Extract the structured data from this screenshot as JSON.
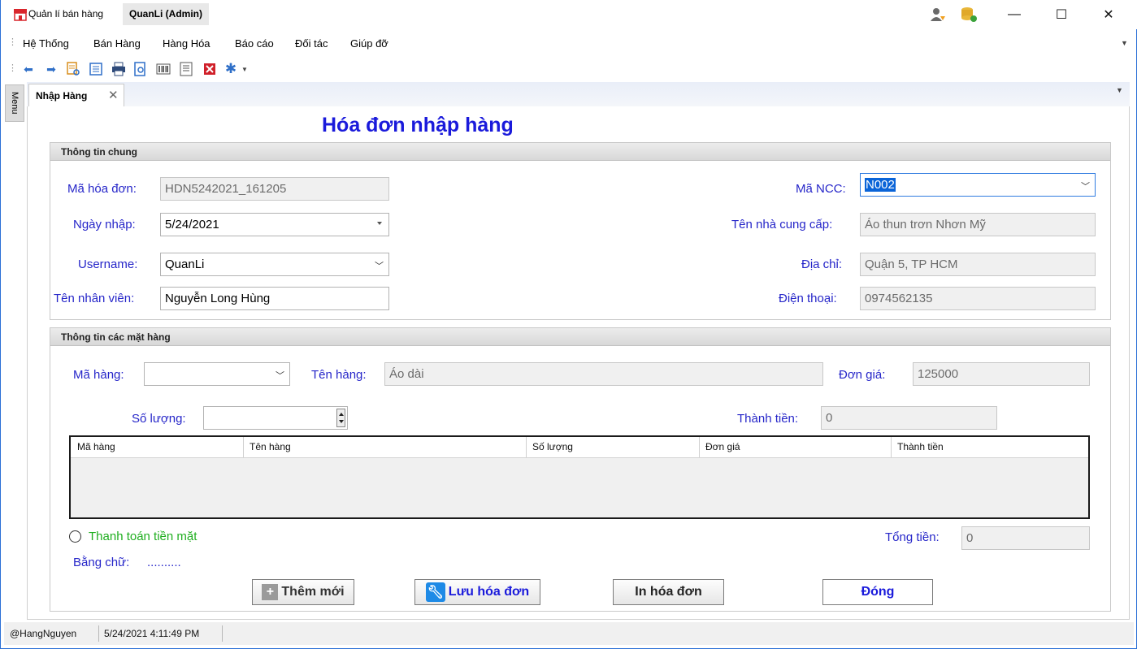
{
  "titlebar": {
    "app_title": "Quản lí bán hàng",
    "user_title": "QuanLi (Admin)",
    "minimize": "—",
    "maximize": "☐",
    "close": "✕"
  },
  "menu": {
    "items": [
      "Hệ Thống",
      "Bán Hàng",
      "Hàng Hóa",
      "Báo cáo",
      "Đối tác",
      "Giúp đỡ"
    ]
  },
  "toolbar": {
    "icons": [
      "undo-icon",
      "redo-icon",
      "search-document-icon",
      "list-icon",
      "print-icon",
      "print-preview-icon",
      "barcode-icon",
      "report-icon",
      "delete-icon",
      "settings-icon"
    ]
  },
  "side_menu": {
    "label": "Menu"
  },
  "document_tab": {
    "label": "Nhập Hàng",
    "close": "✕"
  },
  "form": {
    "title": "Hóa đơn nhập hàng",
    "general_group": "Thông tin chung",
    "invoice_id_label": "Mã hóa đơn:",
    "invoice_id_value": "HDN5242021_161205",
    "date_label": "Ngày nhập:",
    "date_value": "5/24/2021",
    "username_label": "Username:",
    "username_value": "QuanLi",
    "employee_label": "Tên nhân viên:",
    "employee_value": "Nguyễn Long Hùng",
    "supplier_id_label": "Mã NCC:",
    "supplier_id_value": "N002",
    "supplier_name_label": "Tên nhà cung cấp:",
    "supplier_name_value": "Áo thun trơn Nhơn Mỹ",
    "address_label": "Địa chỉ:",
    "address_value": "Quận 5, TP HCM",
    "phone_label": "Điện thoại:",
    "phone_value": "0974562135",
    "items_group": "Thông tin các mặt hàng",
    "item_code_label": "Mã hàng:",
    "item_code_value": "",
    "item_name_label": "Tên hàng:",
    "item_name_value": "Áo dài",
    "unit_price_label": "Đơn giá:",
    "unit_price_value": "125000",
    "quantity_label": "Số lượng:",
    "quantity_value": "",
    "line_total_label": "Thành tiền:",
    "line_total_value": "0",
    "grid_columns": [
      "Mã hàng",
      "Tên hàng",
      "Số lượng",
      "Đơn giá",
      "Thành tiền"
    ],
    "grid_rows": [],
    "cash_payment_label": "Thanh toán tiền mặt",
    "total_label": "Tổng tiền:",
    "total_value": "0",
    "in_words_label": "Bằng chữ:",
    "in_words_value": "..........",
    "buttons": {
      "add_new": "Thêm mới",
      "save_invoice": "Lưu hóa đơn",
      "print_invoice": "In hóa đơn",
      "close": "Đóng"
    }
  },
  "statusbar": {
    "user": "@HangNguyen",
    "datetime": "5/24/2021 4:11:49 PM"
  },
  "colors": {
    "label_blue": "#2626c9",
    "title_blue": "#1a1adb",
    "payment_green": "#1fae1f",
    "selection_blue": "#0a64d8"
  }
}
